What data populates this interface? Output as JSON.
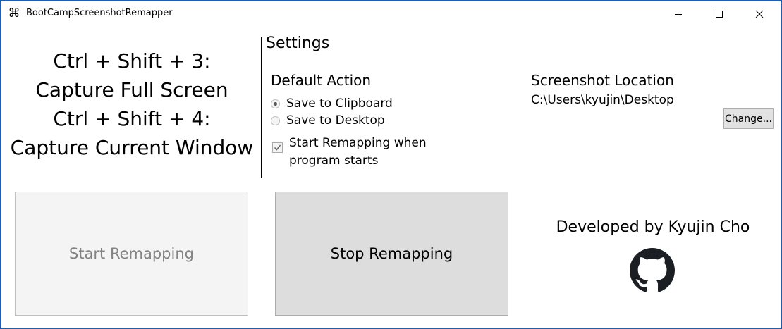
{
  "window": {
    "title": "BootCampScreenshotRemapper",
    "app_icon": "command-key-icon",
    "app_icon_glyph": "⌘",
    "controls": [
      "minimize-icon",
      "maximize-icon",
      "close-icon"
    ]
  },
  "shortcuts": {
    "line1": "Ctrl + Shift + 3:",
    "line2": "Capture Full Screen",
    "line3": "Ctrl + Shift + 4:",
    "line4": "Capture Current Window"
  },
  "settings": {
    "title": "Settings",
    "default_action": {
      "title": "Default Action",
      "options": [
        {
          "label": "Save to Clipboard",
          "selected": true
        },
        {
          "label": "Save to Desktop",
          "selected": false
        }
      ]
    },
    "start_on_launch": {
      "label": "Start Remapping when program starts",
      "checked": true
    },
    "screenshot_location": {
      "title": "Screenshot Location",
      "path": "C:\\Users\\kyujin\\Desktop",
      "change_label": "Change..."
    }
  },
  "actions": {
    "start_label": "Start Remapping",
    "start_enabled": false,
    "stop_label": "Stop Remapping",
    "stop_enabled": true
  },
  "credits": {
    "text": "Developed by Kyujin Cho",
    "icon": "github-icon"
  }
}
